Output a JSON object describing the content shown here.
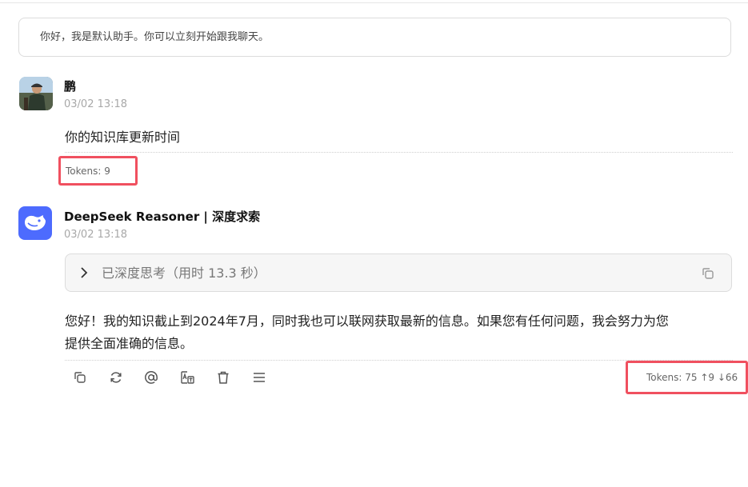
{
  "greeting": "你好，我是默认助手。你可以立刻开始跟我聊天。",
  "user_message": {
    "name": "鹏",
    "time": "03/02 13:18",
    "text": "你的知识库更新时间",
    "tokens": "Tokens: 9"
  },
  "assistant_message": {
    "name": "DeepSeek Reasoner | 深度求索",
    "time": "03/02 13:18",
    "thinking_label": "已深度思考（用时 13.3 秒）",
    "text_line1": "您好！我的知识截止到2024年7月，同时我也可以联网获取最新的信息。如果您有任何问题，我会努力为您",
    "text_line2": "提供全面准确的信息。",
    "tokens": "Tokens: 75 ↑9 ↓66"
  },
  "toolbar_icons": [
    "copy-icon",
    "regenerate-icon",
    "mention-icon",
    "translate-icon",
    "delete-icon",
    "menu-icon"
  ],
  "colors": {
    "accent": "#4d6bfe",
    "highlight_border": "#f0505f",
    "muted_text": "#a8a8a8"
  }
}
